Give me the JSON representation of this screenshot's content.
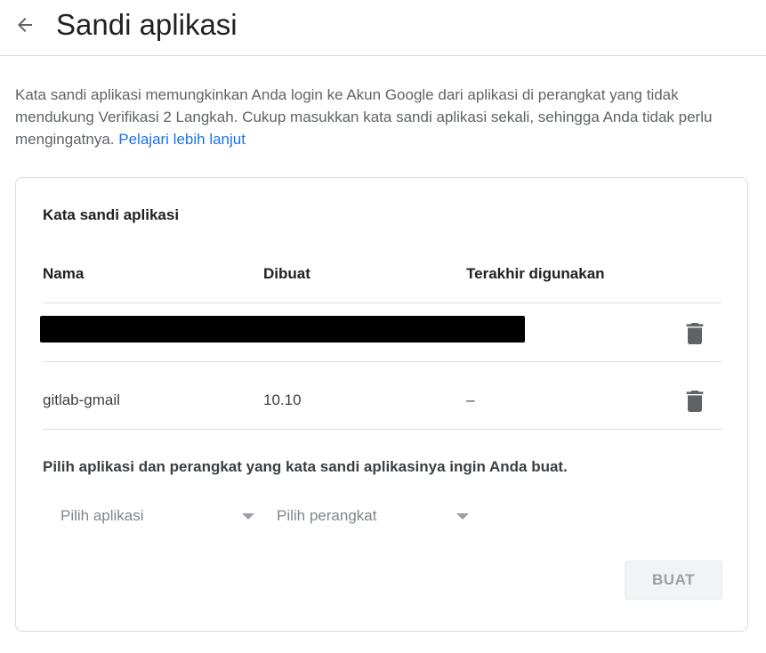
{
  "header": {
    "title": "Sandi aplikasi"
  },
  "intro": {
    "text": "Kata sandi aplikasi memungkinkan Anda login ke Akun Google dari aplikasi di perangkat yang tidak mendukung Verifikasi 2 Langkah. Cukup masukkan kata sandi aplikasi sekali, sehingga Anda tidak perlu mengingatnya.",
    "link": "Pelajari lebih lanjut"
  },
  "card": {
    "title": "Kata sandi aplikasi",
    "columns": {
      "name": "Nama",
      "created": "Dibuat",
      "last_used": "Terakhir digunakan"
    },
    "rows": [
      {
        "name": "",
        "created": "",
        "last_used": "",
        "redacted": true
      },
      {
        "name": "gitlab-gmail",
        "created": "10.10",
        "last_used": "–"
      }
    ],
    "instruction": "Pilih aplikasi dan perangkat yang kata sandi aplikasinya ingin Anda buat.",
    "select_app": "Pilih aplikasi",
    "select_device": "Pilih perangkat",
    "create_button": "BUAT"
  },
  "colors": {
    "link": "#1a73e8",
    "divider": "#dadce0",
    "muted_text": "#5f6368",
    "disabled_button_bg": "#f1f3f4"
  }
}
